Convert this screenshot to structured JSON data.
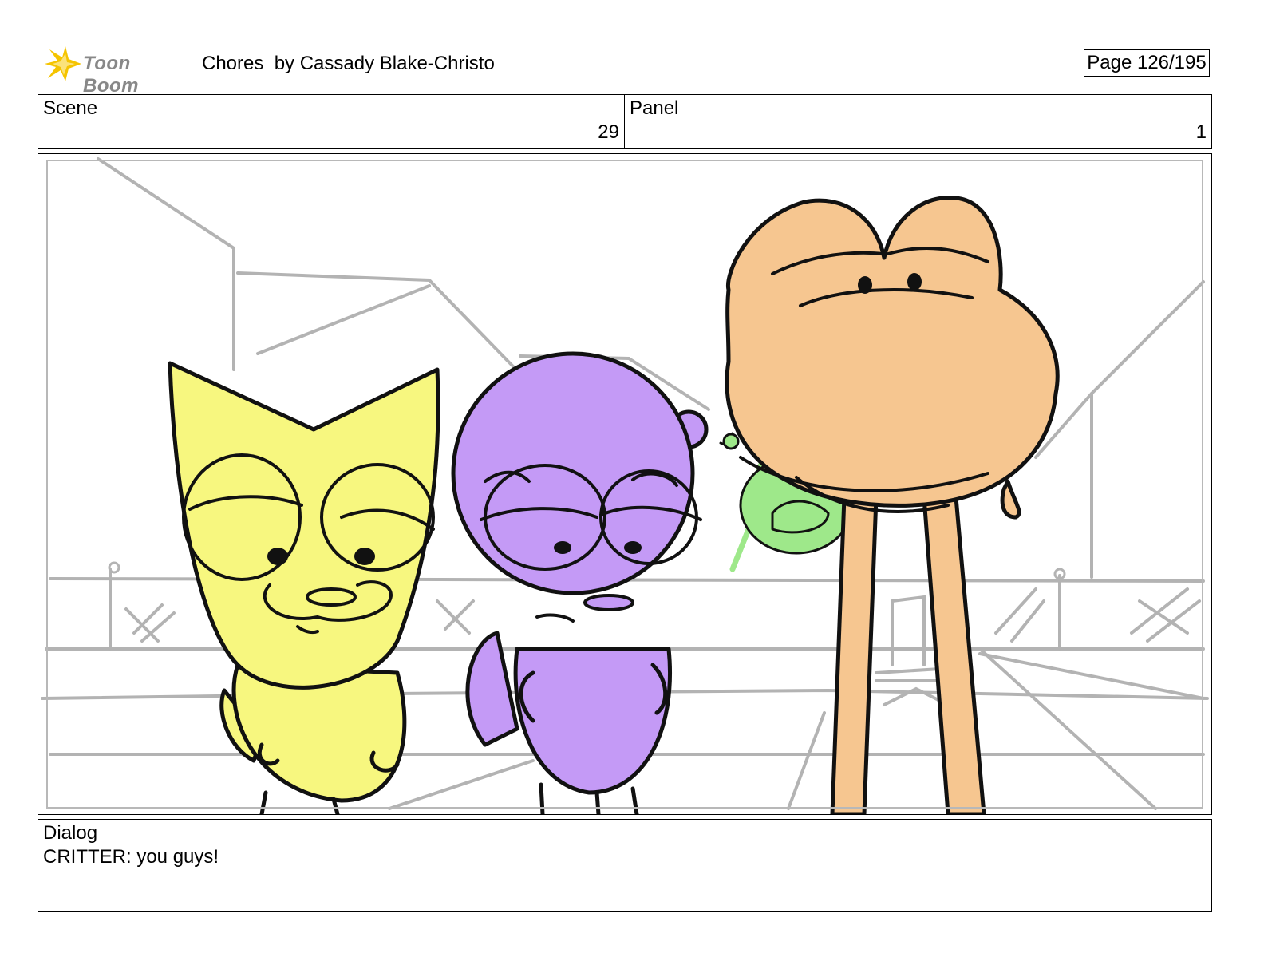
{
  "header": {
    "logo_text": "Toon Boom",
    "title": "Chores  by Cassady Blake-Christo",
    "page": "Page 126/195"
  },
  "scene": {
    "label": "Scene",
    "value": "29"
  },
  "panel": {
    "label": "Panel",
    "value": "1"
  },
  "dialog": {
    "label": "Dialog",
    "text": "CRITTER: you guys!"
  },
  "colors": {
    "yellow_character": "#f7f77f",
    "purple_character": "#c49af6",
    "orange_character": "#f6c690",
    "green_character": "#9ee88a",
    "sketch_lines": "#b3b3b3",
    "logo_flash": "#f5c400"
  }
}
